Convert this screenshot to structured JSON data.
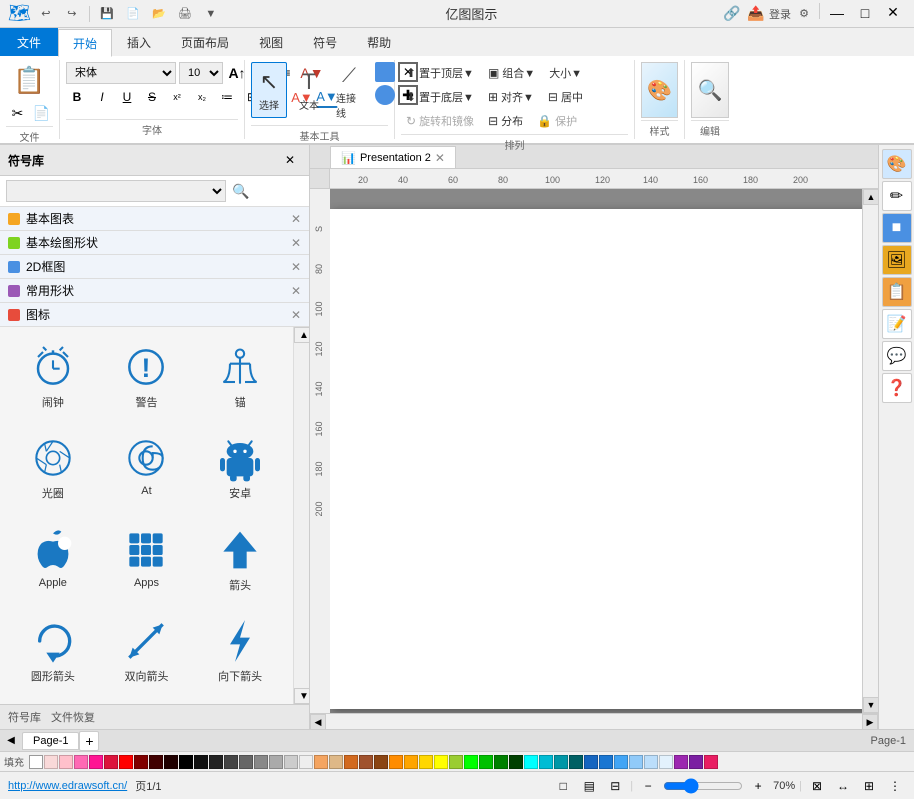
{
  "app": {
    "title": "亿图图示",
    "url": "http://www.edrawsoft.cn/",
    "page_info": "页1/1"
  },
  "title_bar": {
    "quick_actions": [
      "↩",
      "↪",
      "💾",
      "🖨",
      "📋"
    ],
    "window_controls": [
      "—",
      "□",
      "✕"
    ]
  },
  "ribbon": {
    "tabs": [
      "文件",
      "开始",
      "插入",
      "页面布局",
      "视图",
      "符号",
      "帮助"
    ],
    "active_tab": "开始",
    "file_tab": "文件",
    "groups": {
      "clipboard": {
        "label": "文件",
        "buttons": []
      },
      "font": {
        "label": "字体",
        "name": "宋体",
        "size": "10"
      },
      "basic_tools": {
        "label": "基本工具",
        "buttons": [
          "选择",
          "文本",
          "连接线"
        ]
      },
      "arrange": {
        "label": "排列",
        "top_buttons": [
          "置于顶层",
          "组合",
          "大小"
        ],
        "bottom_buttons": [
          "置于底层",
          "对齐",
          "居中"
        ],
        "rotate": "旋转和镜像",
        "distribute": "分布",
        "protect": "保护"
      },
      "style": {
        "label": "样式"
      },
      "edit": {
        "label": "编辑"
      }
    }
  },
  "symbol_library": {
    "title": "符号库",
    "search_placeholder": "",
    "categories": [
      {
        "name": "基本图表",
        "color": "#f5a623"
      },
      {
        "name": "基本绘图形状",
        "color": "#7ed321"
      },
      {
        "name": "2D框图",
        "color": "#4a90e2"
      },
      {
        "name": "常用形状",
        "color": "#9b59b6"
      },
      {
        "name": "图标",
        "color": "#e74c3c"
      }
    ],
    "symbols": [
      {
        "id": "alarm",
        "label": "闹钟",
        "unicode": "⏰"
      },
      {
        "id": "warning",
        "label": "警告",
        "unicode": "❗"
      },
      {
        "id": "anchor",
        "label": "锚",
        "unicode": "⚓"
      },
      {
        "id": "aperture",
        "label": "光圈",
        "unicode": "◎"
      },
      {
        "id": "at",
        "label": "At",
        "unicode": "@"
      },
      {
        "id": "android",
        "label": "安卓",
        "unicode": "🤖"
      },
      {
        "id": "apple",
        "label": "Apple",
        "unicode": ""
      },
      {
        "id": "apps",
        "label": "Apps",
        "unicode": "⋮⋮⋮"
      },
      {
        "id": "arrow-up",
        "label": "箭头",
        "unicode": "↑"
      },
      {
        "id": "arrow-circle",
        "label": "圆形箭头",
        "unicode": "↺"
      },
      {
        "id": "arrow-two",
        "label": "双向箭头",
        "unicode": "↗"
      },
      {
        "id": "arrow-down",
        "label": "向下箭头",
        "unicode": "⚡"
      }
    ],
    "footer": [
      "符号库",
      "文件恢复"
    ]
  },
  "canvas": {
    "tab_name": "Presentation 2",
    "ruler_marks": [
      "20",
      "40",
      "60",
      "80",
      "100",
      "120",
      "140",
      "160",
      "180",
      "200"
    ]
  },
  "page_tabs": {
    "tabs": [
      "Page-1"
    ],
    "active": "Page-1",
    "add_label": "+"
  },
  "status_bar": {
    "link": "http://www.edrawsoft.cn/",
    "page_info": "页1/1",
    "zoom": "70%",
    "view_buttons": [
      "□",
      "▤",
      "⊟"
    ]
  },
  "right_panel": {
    "buttons": [
      "🖌",
      "✏",
      "🟦",
      "🖼",
      "📋",
      "📝",
      "💬",
      "❓"
    ]
  },
  "colors": {
    "accent_blue": "#0078d7",
    "tab_file_bg": "#0078d7",
    "symbol_color": "#1a78c2"
  }
}
